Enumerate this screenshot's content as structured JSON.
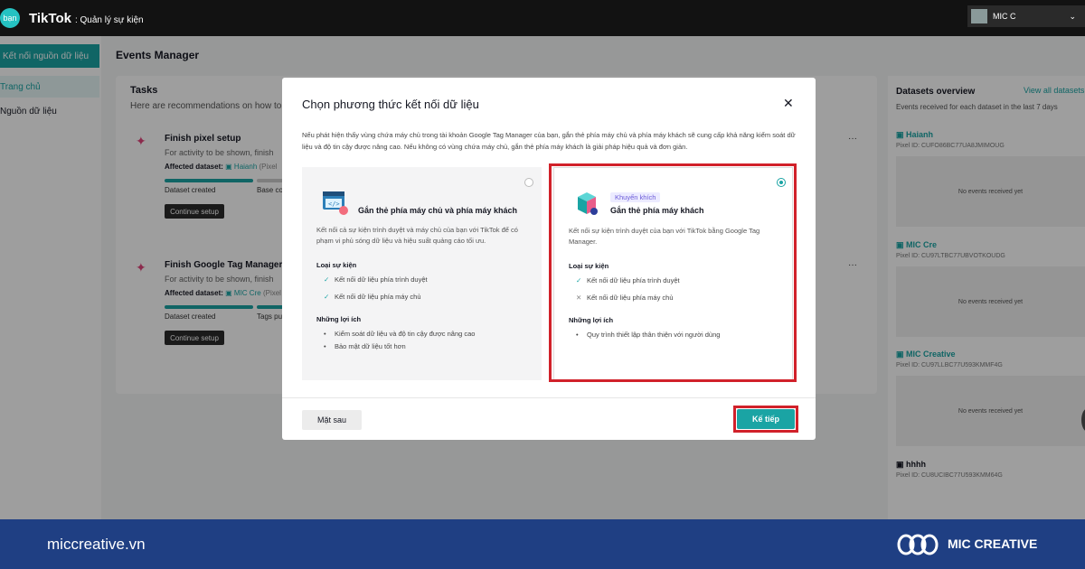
{
  "topbar": {
    "logo_text": "bạn",
    "brand": "TikTok",
    "brand_suffix": ": Quản lý sự kiện",
    "account_name": "MIC C"
  },
  "sidebar": {
    "connect_button": "Kết nối nguồn dữ liệu",
    "items": [
      "Trang chủ",
      "Nguồn dữ liệu"
    ]
  },
  "main": {
    "title": "Events Manager",
    "tasks": {
      "heading": "Tasks",
      "subheading": "Here are recommendations on how to f",
      "items": [
        {
          "title": "Finish pixel setup",
          "desc": "For activity to be shown, finish",
          "affected_label": "Affected dataset:",
          "dataset": "Haianh",
          "dataset_suffix": "(Pixel",
          "step1": "Dataset created",
          "step2": "Base co",
          "action": "Continue setup"
        },
        {
          "title": "Finish Google Tag Manager C",
          "desc": "For activity to be shown, finish",
          "affected_label": "Affected dataset:",
          "dataset": "MIC Cre",
          "dataset_suffix": "(Pixel",
          "step1": "Dataset created",
          "step2": "Tags pu",
          "action": "Continue setup"
        }
      ]
    }
  },
  "datasets": {
    "heading": "Datasets overview",
    "view_all": "View all datasets",
    "subheading": "Events received for each dataset in the last 7 days",
    "items": [
      {
        "name": "Haianh",
        "pixel_id": "Pixel ID: CUFO86BC77UA8JMIMOUG",
        "empty": "No events received yet"
      },
      {
        "name": "MIC Cre",
        "pixel_id": "Pixel ID: CU97LTBC77UBVOTKOUDG",
        "empty": "No events received yet"
      },
      {
        "name": "MIC Creative",
        "pixel_id": "Pixel ID: CU97LLBC77U593KMMF4G",
        "empty": "No events received yet"
      },
      {
        "name": "hhhh",
        "pixel_id": "Pixel ID: CU8UCIBC77U593KMM64G"
      }
    ]
  },
  "modal": {
    "title": "Chọn phương thức kết nối dữ liệu",
    "description": "Nếu phát hiện thấy vùng chứa máy chủ trong tài khoản Google Tag Manager của bạn, gắn thẻ phía máy chủ và phía máy khách sẽ cung cấp khả năng kiểm soát dữ liệu và độ tin cậy được nâng cao. Nếu không có vùng chứa máy chủ, gắn thẻ phía máy khách là giải pháp hiệu quả và đơn giản.",
    "options": [
      {
        "title": "Gắn thẻ phía máy chủ và phía máy khách",
        "desc": "Kết nối cả sự kiện trình duyệt và máy chủ của bạn với TikTok để có phạm vi phủ sóng dữ liệu và hiệu suất quảng cáo tối ưu.",
        "events_heading": "Loại sự kiện",
        "events": [
          "Kết nối dữ liệu phía trình duyệt",
          "Kết nối dữ liệu phía máy chủ"
        ],
        "benefits_heading": "Những lợi ích",
        "benefits": [
          "Kiểm soát dữ liệu và độ tin cậy được nâng cao",
          "Bảo mật dữ liệu tốt hơn"
        ]
      },
      {
        "badge": "Khuyến khích",
        "title": "Gắn thẻ phía máy khách",
        "desc": "Kết nối sự kiện trình duyệt của bạn với TikTok bằng Google Tag Manager.",
        "events_heading": "Loại sự kiện",
        "events": [
          "Kết nối dữ liệu phía trình duyệt",
          "Kết nối dữ liệu phía máy chủ"
        ],
        "benefits_heading": "Những lợi ích",
        "benefits": [
          "Quy trình thiết lập thân thiện với người dùng"
        ]
      }
    ],
    "later_button": "Mặt sau",
    "next_button": "Kế tiếp"
  },
  "footer": {
    "site": "miccreative.vn",
    "brand": "MIC CREATIVE"
  },
  "colors": {
    "accent": "#1aa4a4",
    "highlight": "#d1212a",
    "footer": "#1f3f83"
  }
}
